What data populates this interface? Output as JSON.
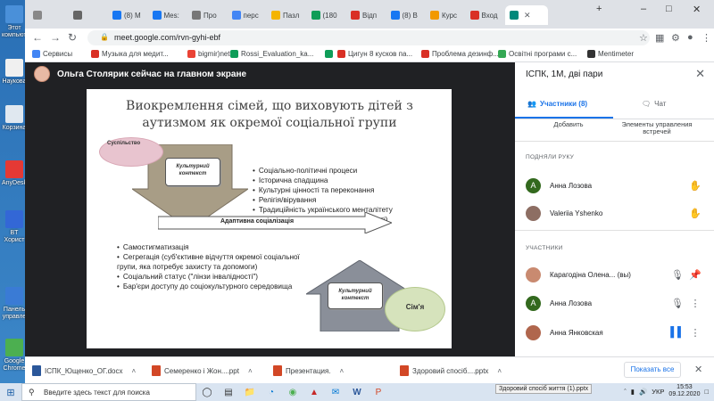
{
  "desktop": {
    "icons": [
      {
        "label": "Этот компьютер",
        "color": "#4a90d9"
      },
      {
        "label": "Наукова",
        "color": "#f0f0f0"
      },
      {
        "label": "Корзина",
        "color": "#e0e8f0"
      },
      {
        "label": "AnyDesk",
        "color": "#e53935"
      },
      {
        "label": "BT Хорист",
        "color": "#3367d6"
      },
      {
        "label": "Панель управле",
        "color": "#3a7bd5"
      },
      {
        "label": "Google Chrome",
        "color": "#4caf50"
      }
    ]
  },
  "tabs": [
    {
      "label": "",
      "icon": "mail-icon",
      "color": "#888"
    },
    {
      "label": "",
      "icon": "ukr-icon",
      "color": "#666"
    },
    {
      "label": "(8) М",
      "icon": "facebook-icon",
      "color": "#1877f2"
    },
    {
      "label": "Mes:",
      "icon": "messenger-icon",
      "color": "#1877f2"
    },
    {
      "label": "Про",
      "icon": "page-icon",
      "color": "#777"
    },
    {
      "label": "перс",
      "icon": "google-icon",
      "color": "#4285f4"
    },
    {
      "label": "Пазл",
      "icon": "puzzle-icon",
      "color": "#f4b400"
    },
    {
      "label": "(180",
      "icon": "sheets-icon",
      "color": "#0f9d58"
    },
    {
      "label": "Відп",
      "icon": "doc-icon",
      "color": "#d93025"
    },
    {
      "label": "(8) В",
      "icon": "facebook-icon",
      "color": "#1877f2"
    },
    {
      "label": "Курс",
      "icon": "course-icon",
      "color": "#f29900"
    },
    {
      "label": "Вход",
      "icon": "gmail-icon",
      "color": "#d93025"
    },
    {
      "label": "",
      "icon": "meet-icon",
      "color": "#00897b",
      "active": true
    }
  ],
  "toolbar": {
    "url": "meet.google.com/rvn-gyhi-ebf"
  },
  "bookmarks": [
    {
      "label": "Сервисы",
      "color": "#4285f4"
    },
    {
      "label": "Музыка для медит...",
      "color": "#d93025"
    },
    {
      "label": "bigmir)net",
      "color": "#ea4335"
    },
    {
      "label": "Rossi_Evaluation_ka...",
      "color": "#0f9d58"
    },
    {
      "label": "",
      "color": "#0f9d58"
    },
    {
      "label": "Цигун 8 кусков па...",
      "color": "#d93025"
    },
    {
      "label": "Проблема дезинф...",
      "color": "#d93025"
    },
    {
      "label": "Освітні програми с...",
      "color": "#34a853"
    },
    {
      "label": "Mentimeter",
      "color": "#333"
    }
  ],
  "meet": {
    "presenter": "Ольга Столярик сейчас на главном экране",
    "slide": {
      "title_line1": "Виокремлення сімей, що виховують дітей з",
      "title_line2": "аутизмом як окремої соціальної групи",
      "society": "Суспільство",
      "context_top": "Культурний контекст",
      "top_bullets": [
        "Соціально-політичні процеси",
        "Історична спадщина",
        "Культурні цінності та переконання",
        "Релігія/вірування",
        "Традиційність українського менталітету",
        "Культурна стигма (стигма ввічливості)"
      ],
      "arrow_label": "Адаптивна соціалізація",
      "bottom_bullets": [
        "Самостигматизація",
        "Сегрегація (суб'єктивне відчуття окремої соціальної групи, яка потребує захисту та допомоги)",
        "Соціальний статус (\"лінзи інвалідності\")",
        "Бар'єри доступу до соціокультурного середовища"
      ],
      "context_bottom": "Культурний контекст",
      "family": "Сім'я"
    },
    "panel": {
      "title": "ІСПК, 1М, дві пари",
      "tab_people": "Участники (8)",
      "tab_chat": "Чат",
      "add": "Добавить",
      "controls": "Элементы управления встречей",
      "raised_section": "ПОДНЯЛИ РУКУ",
      "raised": [
        {
          "name": "Анна Лозова",
          "initial": "A",
          "color": "#33691e"
        },
        {
          "name": "Valeriia Yshenko",
          "initial": "",
          "color": "#8d6e63"
        }
      ],
      "participants_section": "УЧАСТНИКИ",
      "participants": [
        {
          "name": "Карагодіна Олена... (вы)",
          "initial": "",
          "color": "#c98a70"
        },
        {
          "name": "Анна Лозова",
          "initial": "A",
          "color": "#33691e"
        },
        {
          "name": "Анна Янковская",
          "initial": "",
          "color": "#b0664d"
        }
      ]
    }
  },
  "downloads": [
    {
      "name": "ІСПК_Ющенко_ОГ.docx",
      "color": "#2b579a"
    },
    {
      "name": "Семеренко і Жон....ppt",
      "color": "#d24726"
    },
    {
      "name": "Презентация.",
      "color": "#d24726"
    },
    {
      "name": "Здоровий спосіб....pptx",
      "color": "#d24726"
    }
  ],
  "downloads_showall": "Показать все",
  "taskbar": {
    "search_placeholder": "Введите здесь текст для поиска",
    "tooltip": "Здоровий спосіб життя (1).pptx",
    "lang": "УКР",
    "time": "15:53",
    "date": "09.12.2020"
  }
}
